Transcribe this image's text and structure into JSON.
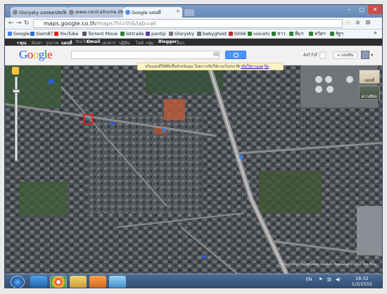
{
  "browser": {
    "tabs": [
      {
        "label": "Glorysky แอลพคปทบท ไปล"
      },
      {
        "label": "www.centralhome.co.th"
      },
      {
        "label": "Google แผนที่"
      }
    ],
    "url_host": "maps.google.co.th",
    "url_path": "/maps?hl=th&tab=wl"
  },
  "bookmarks": [
    {
      "label": "Google",
      "color": "#4285f4"
    },
    {
      "label": "SiamBT",
      "color": "#2b6bd6"
    },
    {
      "label": "YouTube",
      "color": "#e62117"
    },
    {
      "label": "Torrent Move",
      "color": "#555"
    },
    {
      "label": "lettrade",
      "color": "#2e7d32"
    },
    {
      "label": "pantip",
      "color": "#5b3fa0"
    },
    {
      "label": "Glorysky",
      "color": "#777"
    },
    {
      "label": "babyghost",
      "color": "#777"
    },
    {
      "label": "bit66",
      "color": "#c62828"
    },
    {
      "label": "voicetv",
      "color": "#2e7d32"
    },
    {
      "label": "ข่าว",
      "color": "#2e7d32"
    },
    {
      "label": "ทีมฯ",
      "color": "#2e7d32"
    },
    {
      "label": "ทวิตฯ",
      "color": "#2e7d32"
    },
    {
      "label": "รัฐฯ",
      "color": "#2e7d32"
    }
  ],
  "google_bar": {
    "items": [
      "+คุณ",
      "ค้นหา",
      "รูปภาพ",
      "แผนที่",
      "YouTube",
      "Gmail",
      "เอกสาร",
      "ปฏิทิน",
      "ไซต์",
      "กลุ่ม",
      "Blogger",
      "อื่นๆ"
    ],
    "active": "แผนที่"
  },
  "header": {
    "logo": "Google",
    "user_name": "Asf Fsf",
    "share_label": "+ แบ่งปัน"
  },
  "notice": {
    "text": "ปรับแผนที่ให้ดียิ่งขึ้นสำหรับคุณ โดยการเปิดใช้งานเว็บประวัติ",
    "link": "เปิดใช้งานเลย",
    "dismiss": "ปิด"
  },
  "map": {
    "map_types": [
      "แผนที่",
      "ดาวเทียม"
    ],
    "copyright": "ภาพ ©2012 DigitalGlobe, GeoEye, ข้อมูลแผนที่ ©2012 Tele Atlas"
  },
  "taskbar": {
    "lang": "EN",
    "time": "18:32",
    "date": "1/3/2555"
  }
}
